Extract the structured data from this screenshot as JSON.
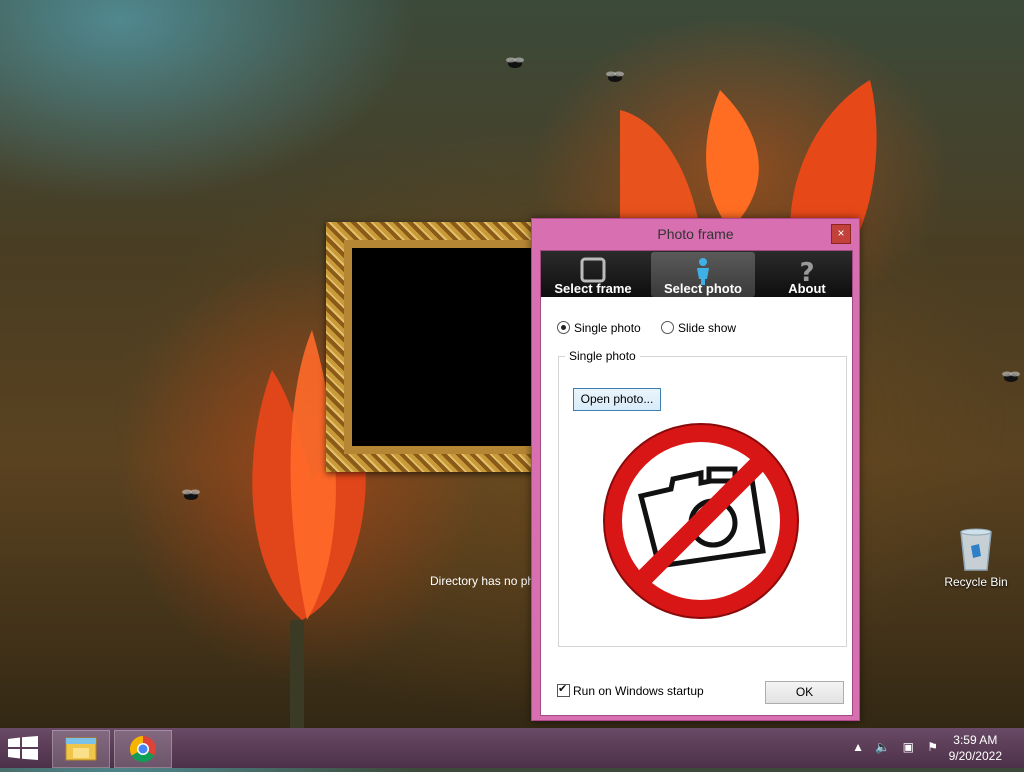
{
  "frame_widget": {
    "message": "Directory has no photo"
  },
  "dialog": {
    "title": "Photo frame",
    "close_symbol": "×",
    "toolbar": [
      {
        "label": "Select frame",
        "icon": "square-frame-icon"
      },
      {
        "label": "Select photo",
        "icon": "person-icon",
        "active": true
      },
      {
        "label": "About",
        "icon": "question-icon"
      }
    ],
    "mode": {
      "single_label": "Single photo",
      "slideshow_label": "Slide show",
      "selected": "Single photo"
    },
    "group_title": "Single photo",
    "open_button": "Open photo...",
    "preview_icon": "no-photo-icon",
    "startup_label": "Run on Windows startup",
    "startup_checked": true,
    "ok_button": "OK"
  },
  "desktop": {
    "recycle_bin_label": "Recycle Bin"
  },
  "taskbar": {
    "apps": [
      "file-explorer-icon",
      "chrome-icon"
    ],
    "clock_time": "3:59 AM",
    "clock_date": "9/20/2022"
  },
  "colors": {
    "dialog_frame": "#d86fb0",
    "toolbar_bg": "#1a1a1a",
    "taskbar": "#5a3d57"
  }
}
